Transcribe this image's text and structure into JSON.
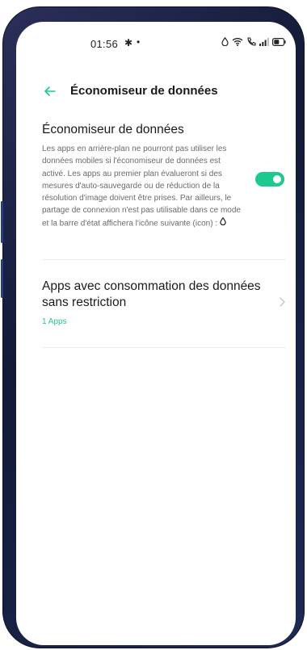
{
  "status_bar": {
    "time": "01:56",
    "icons": [
      "settings-gear-icon",
      "notification-dot-icon",
      "data-saver-icon",
      "wifi-icon",
      "hd-call-icon",
      "signal-icon",
      "battery-icon"
    ]
  },
  "header": {
    "back_icon": "back-arrow-icon",
    "title": "Économiseur de données"
  },
  "data_saver": {
    "title": "Économiseur de données",
    "description": "Les apps en arrière-plan ne pourront pas utiliser les données mobiles si l'économiseur de données est activé. Les apps au premier plan évalueront si des mesures d'auto-sauvegarde ou de réduction de la résolution d'image doivent être prises. Par ailleurs, le partage de connexion n'est pas utilisable dans ce mode et la barre d'état affichera l'icône suivante (icon) :",
    "description_icon": "data-saver-icon",
    "toggle_on": true
  },
  "unrestricted_apps": {
    "title": "Apps avec consommation des données sans restriction",
    "subtitle": "1 Apps",
    "chevron_icon": "chevron-right-icon"
  },
  "colors": {
    "accent": "#1ec98f",
    "text_primary": "#1a1a1a",
    "text_secondary": "#6b6b6b",
    "divider": "#ececec",
    "frame": "#1a2245"
  }
}
